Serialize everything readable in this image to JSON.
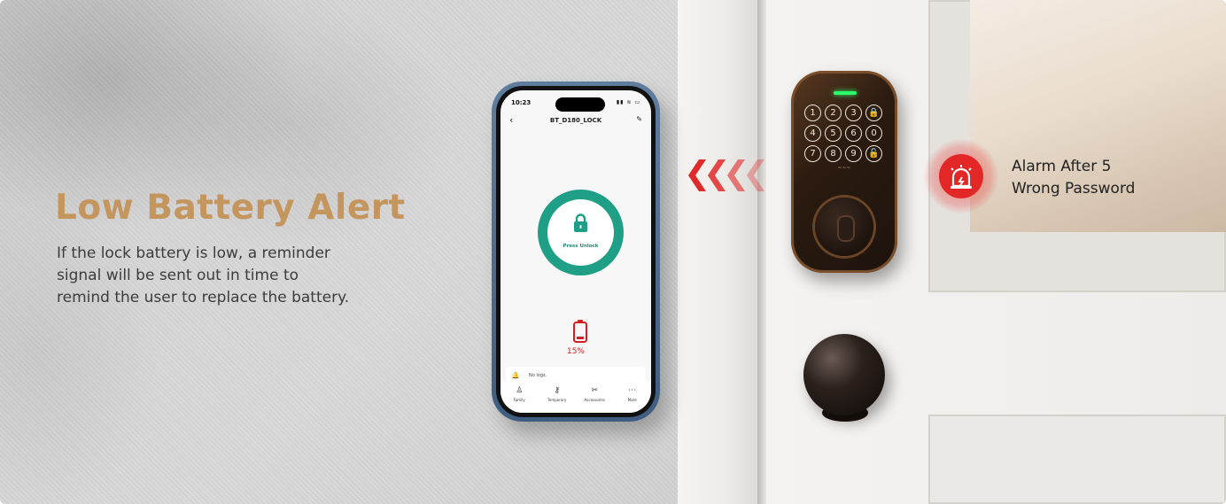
{
  "headline": "Low Battery Alert",
  "description_lines": [
    "If the lock battery is low, a reminder",
    "signal will be sent out in time to",
    "remind the user to replace the battery."
  ],
  "alarm_lines": [
    "Alarm After 5",
    "Wrong Password"
  ],
  "phone": {
    "status_time": "10:23",
    "status_icons": "▮▮ ≋ ▭",
    "nav_back": "‹",
    "title": "BT_D180_LOCK",
    "nav_edit": "✎",
    "unlock_label": "Press Unlock",
    "battery_percent": "15%",
    "log_icon": "🔔",
    "log_text": "No logs.",
    "tabs": [
      {
        "icon": "♙",
        "label": "Family"
      },
      {
        "icon": "⚷",
        "label": "Temporary"
      },
      {
        "icon": "✂",
        "label": "Accessories"
      },
      {
        "icon": "⋯",
        "label": "More"
      }
    ]
  },
  "keypad_keys": [
    "1",
    "2",
    "3",
    "🔒",
    "4",
    "5",
    "6",
    "0",
    "7",
    "8",
    "9",
    "🔓"
  ],
  "colors": {
    "headline": "#c4955d",
    "accent_green": "#1f9f85",
    "alert_red": "#e32626",
    "arrow_red": "#e02a2a"
  },
  "icons": [
    "signal-arrows-icon",
    "alarm-siren-icon",
    "padlock-icon",
    "low-battery-icon"
  ]
}
